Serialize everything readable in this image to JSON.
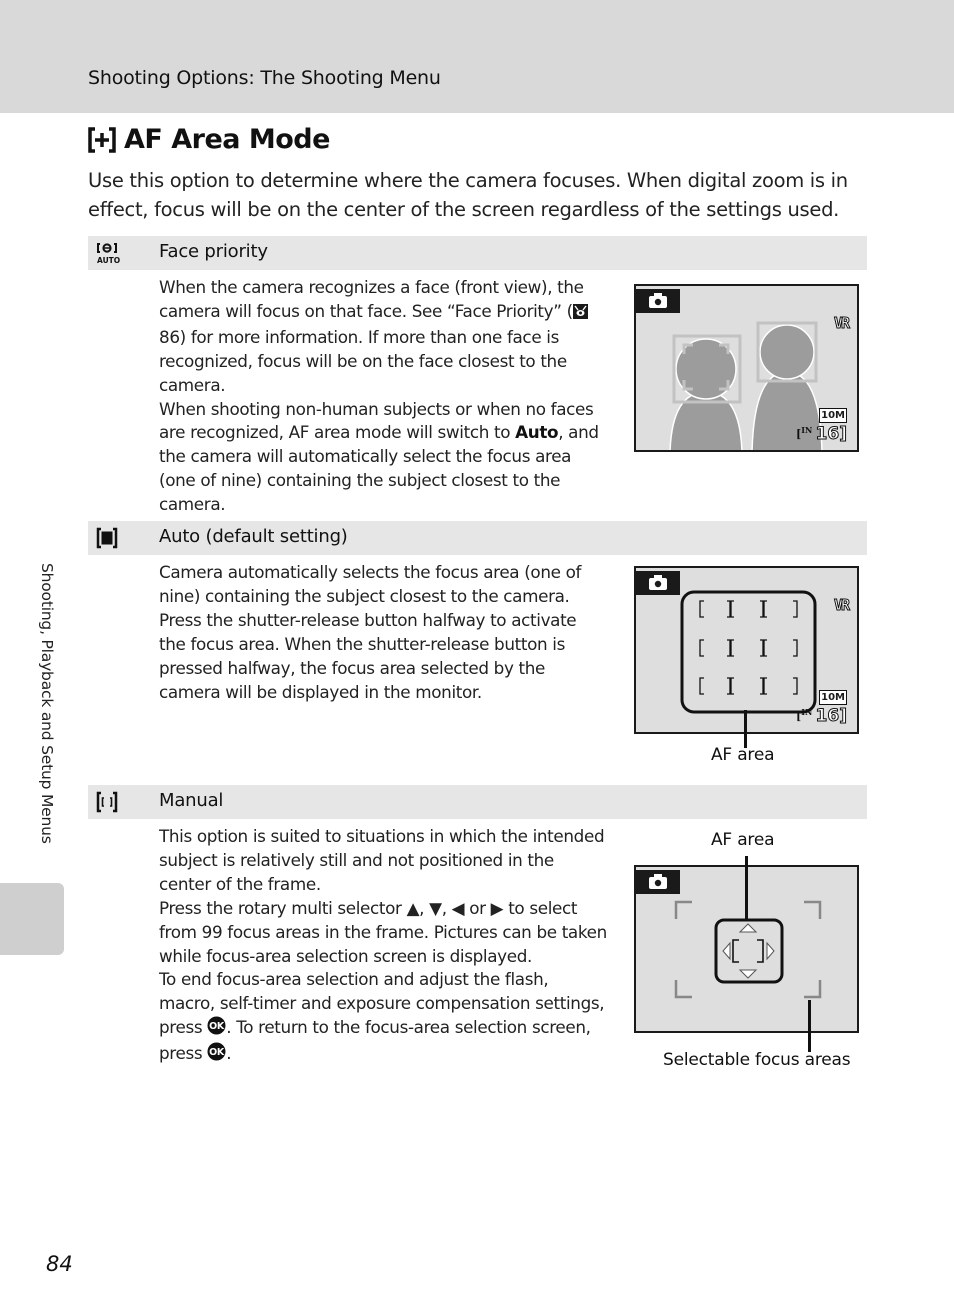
{
  "header": {
    "section_title": "Shooting Options: The Shooting Menu"
  },
  "page": {
    "title": "AF Area Mode",
    "title_icon": "af-area-mode-icon",
    "intro": "Use this option to determine where the camera focuses. When digital zoom is in effect, focus will be on the center of the screen regardless of the settings used."
  },
  "options": [
    {
      "icon": "face-priority-icon",
      "label": "Face priority",
      "desc": {
        "p1_a": "When the camera recognizes a face (front view), the camera will focus on that face. See “Face Priority” (",
        "p1_ref": "86",
        "p1_b": ") for more information. If more than one face is recognized, focus will be on the face closest to the camera.",
        "p2_a": "When shooting non-human subjects or when no faces are recognized,  AF area mode will switch to ",
        "p2_bold": "Auto",
        "p2_b": ", and the camera will automatically select the focus area (one of nine) containing the subject closest to the camera."
      },
      "screen": {
        "vr": "VR",
        "size": "10M",
        "memory": "IN",
        "shots": "16"
      }
    },
    {
      "icon": "auto-area-icon",
      "label": "Auto (default setting)",
      "desc": {
        "p1": "Camera automatically selects the focus area (one of nine) containing the subject closest to the camera. Press the shutter-release button halfway to activate the focus area. When the shutter-release button is pressed halfway, the focus area selected by the camera will be displayed in the monitor."
      },
      "screen": {
        "vr": "VR",
        "size": "10M",
        "memory": "IN",
        "shots": "16"
      },
      "callout": "AF area"
    },
    {
      "icon": "manual-area-icon",
      "label": "Manual",
      "desc": {
        "p1": "This option is suited to situations in which the intended subject is relatively still and not positioned in the center of the frame.",
        "p2_a": "Press the rotary multi selector ",
        "p2_up": "▲",
        "p2_sep1": ", ",
        "p2_down": "▼",
        "p2_sep2": ", ",
        "p2_left": "◀",
        "p2_or": " or ",
        "p2_right": "▶",
        "p2_b": " to select from 99 focus areas in the frame. Pictures can be taken while focus-area selection screen is displayed.",
        "p3_a": "To end focus-area selection and adjust the flash, macro, self-timer and exposure compensation settings, press ",
        "p3_ok": "OK",
        "p3_b": ". To return to the focus-area selection screen, press ",
        "p3_ok2": "OK",
        "p3_c": "."
      },
      "callout_top": "AF area",
      "callout_bottom": "Selectable focus areas"
    }
  ],
  "sidebar": {
    "chapter": "Shooting, Playback and Setup Menus"
  },
  "footer": {
    "page_number": "84"
  }
}
